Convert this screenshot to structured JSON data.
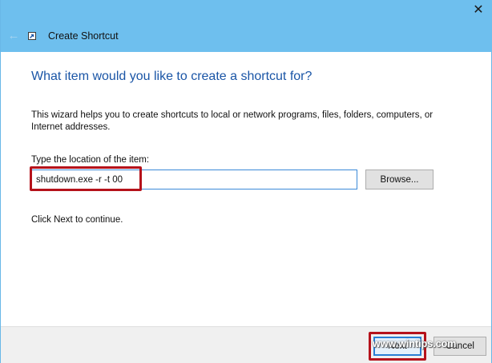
{
  "window": {
    "title": "Create Shortcut",
    "close_glyph": "✕",
    "back_glyph": "←"
  },
  "wizard": {
    "heading": "What item would you like to create a shortcut for?",
    "description": "This wizard helps you to create shortcuts to local or network programs, files, folders, computers, or Internet addresses.",
    "location_label": "Type the location of the item:",
    "location_value": "shutdown.exe -r -t 00",
    "browse_label": "Browse...",
    "hint": "Click Next to continue."
  },
  "footer": {
    "next_label": "Next",
    "cancel_label": "Cancel"
  },
  "watermark": {
    "text": "www.wintips.com"
  },
  "colors": {
    "titlebar": "#6ebfee",
    "heading": "#1a55a6",
    "highlight": "#b5121b",
    "focus": "#3b8ad8"
  },
  "icons": {
    "back": "back-arrow-icon",
    "close": "close-icon",
    "shortcut": "shortcut-icon"
  }
}
